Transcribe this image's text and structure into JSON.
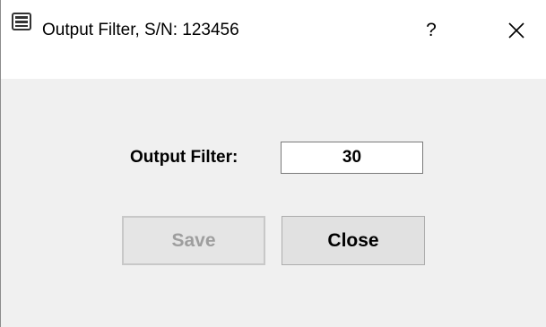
{
  "window": {
    "title": "Output Filter, S/N: 123456",
    "help_label": "?",
    "icons": {
      "app": "app-icon",
      "close": "close-icon"
    }
  },
  "form": {
    "output_filter_label": "Output Filter:",
    "output_filter_value": "30"
  },
  "buttons": {
    "save_label": "Save",
    "save_enabled": false,
    "close_label": "Close"
  }
}
